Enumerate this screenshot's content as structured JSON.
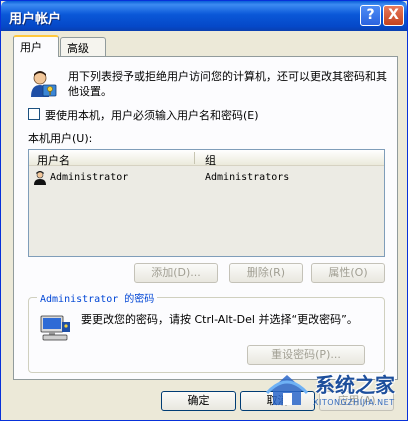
{
  "window": {
    "title": "用户帐户",
    "help_glyph": "?",
    "close_glyph": "X"
  },
  "tabs": [
    {
      "label": "用户",
      "active": true
    },
    {
      "label": "高级",
      "active": false
    }
  ],
  "intro_text": "用下列表授予或拒绝用户访问您的计算机，还可以更改其密码和其他设置。",
  "require_login_checkbox": {
    "label": "要使用本机，用户必须输入用户名和密码(E)",
    "checked": false
  },
  "users_list": {
    "label": "本机用户(U):",
    "columns": [
      "用户名",
      "组"
    ],
    "rows": [
      {
        "name": "Administrator",
        "group": "Administrators"
      }
    ]
  },
  "list_buttons": {
    "add": "添加(D)...",
    "remove": "删除(R)",
    "properties": "属性(O)"
  },
  "password_group": {
    "legend": "Administrator 的密码",
    "text": "要更改您的密码，请按 Ctrl-Alt-Del 并选择“更改密码”。",
    "reset_button": "重设密码(P)..."
  },
  "dialog_buttons": {
    "ok": "确定",
    "cancel": "取消",
    "apply": "应用(A)"
  },
  "watermark": {
    "text": "系统之家",
    "url": "XITONGZHIJIA.NET"
  },
  "colors": {
    "titlebar": "#0a58d8",
    "dialog_bg": "#ece9d8",
    "accent_tab": "#ffc83c",
    "legend_text": "#0046d5"
  },
  "icons": {
    "user_keys": "user-keys-icon",
    "computer": "computer-icon",
    "user_row": "user-icon"
  }
}
